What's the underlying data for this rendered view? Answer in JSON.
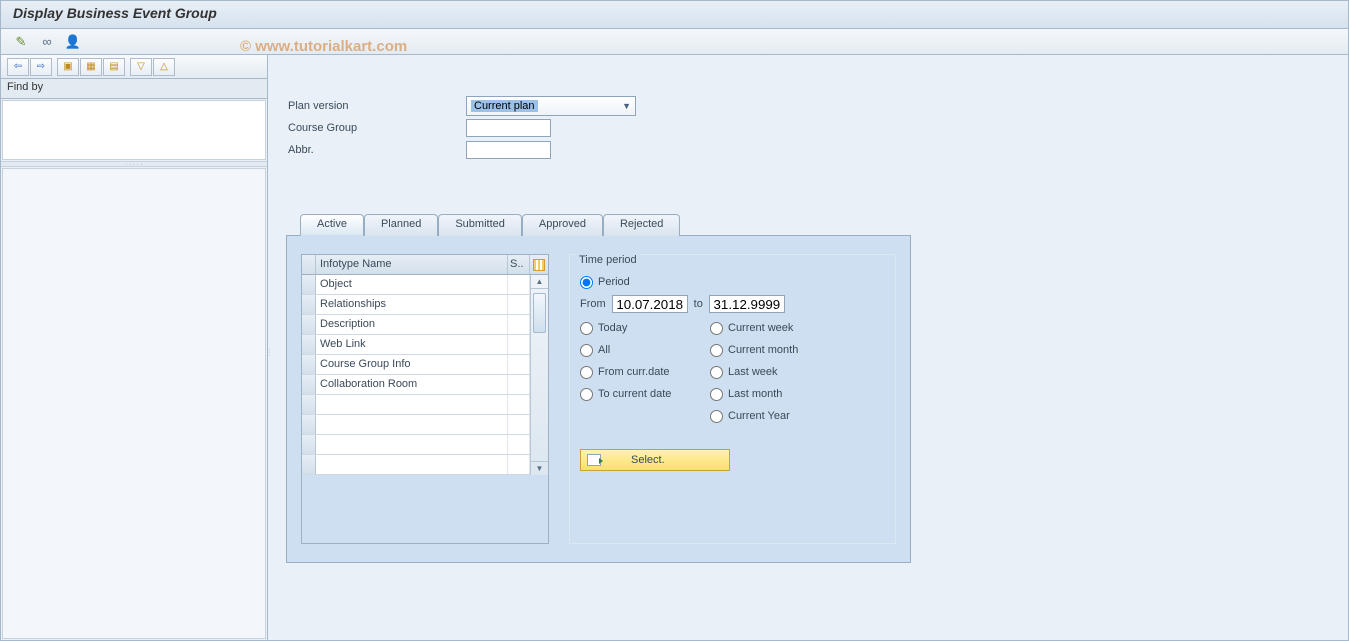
{
  "title": "Display Business Event Group",
  "watermark": "© www.tutorialkart.com",
  "top_toolbar": {
    "btn1": "wand-icon",
    "btn2": "glasses-icon",
    "btn3": "person-icon"
  },
  "sidebar": {
    "toolbar": [
      "back",
      "forward",
      "expand-all",
      "expand",
      "collapse",
      "down-all",
      "up-all"
    ],
    "findby_label": "Find by"
  },
  "form": {
    "plan_version_label": "Plan version",
    "plan_version_value": "Current plan",
    "course_group_label": "Course Group",
    "course_group_value": "",
    "abbr_label": "Abbr.",
    "abbr_value": ""
  },
  "tabs": {
    "t0": "Active",
    "t1": "Planned",
    "t2": "Submitted",
    "t3": "Approved",
    "t4": "Rejected",
    "active_index": 0
  },
  "grid": {
    "head_name": "Infotype Name",
    "head_s": "S..",
    "rows": {
      "r0": "Object",
      "r1": "Relationships",
      "r2": "Description",
      "r3": "Web Link",
      "r4": "Course Group Info",
      "r5": "Collaboration Room",
      "r6": "",
      "r7": "",
      "r8": "",
      "r9": ""
    }
  },
  "time": {
    "title": "Time period",
    "period": "Period",
    "from_label": "From",
    "from_value": "10.07.2018",
    "to_label": "to",
    "to_value": "31.12.9999",
    "today": "Today",
    "all": "All",
    "from_curr": "From curr.date",
    "to_curr": "To current date",
    "cur_week": "Current week",
    "cur_month": "Current month",
    "last_week": "Last week",
    "last_month": "Last month",
    "cur_year": "Current Year",
    "select_btn": "Select."
  }
}
